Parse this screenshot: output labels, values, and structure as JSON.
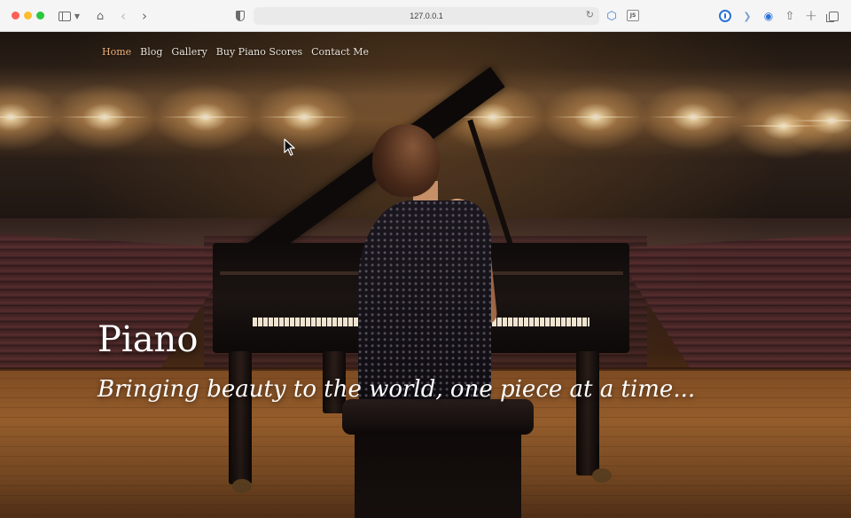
{
  "browser": {
    "address": "127.0.0.1",
    "icons": {
      "sidebar": "sidebar-icon",
      "home": "home-icon",
      "back": "chevron-left-icon",
      "forward": "chevron-right-icon",
      "privacy": "shield-icon",
      "reload": "reload-icon",
      "extension_3d": "cube-icon",
      "extension_js": "JS",
      "password_manager": "onepassword-icon",
      "rss": "rss-icon",
      "camera": "camera-icon",
      "share": "share-icon",
      "new_tab": "plus-icon",
      "tabs": "tabs-icon"
    }
  },
  "nav": {
    "items": [
      {
        "label": "Home",
        "active": true
      },
      {
        "label": "Blog"
      },
      {
        "label": "Gallery"
      },
      {
        "label": "Buy Piano Scores"
      },
      {
        "label": "Contact Me"
      }
    ]
  },
  "hero": {
    "title": "Piano",
    "tagline": "Bringing beauty to the world, one piece at a time..."
  },
  "colors": {
    "nav_active": "#f1b27a",
    "nav_text": "#e9e2da",
    "hero_text": "#ffffff"
  }
}
